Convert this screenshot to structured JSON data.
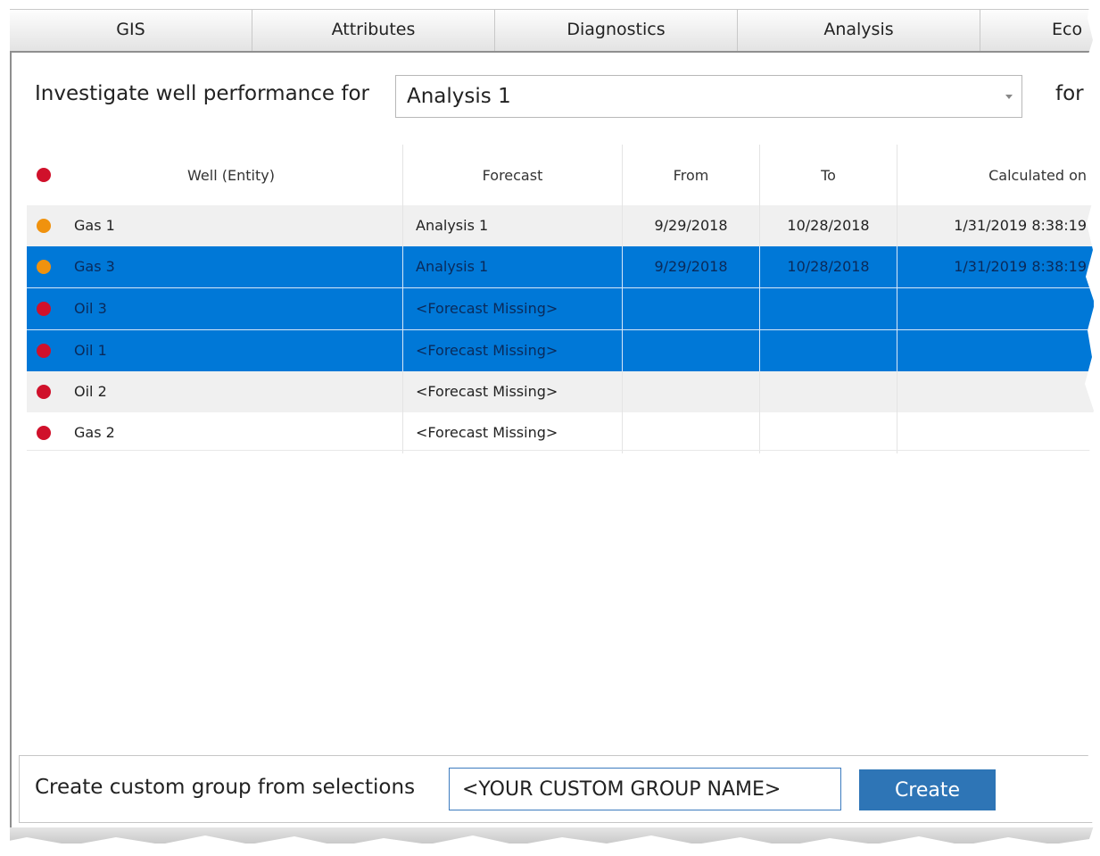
{
  "tabs": [
    "GIS",
    "Attributes",
    "Diagnostics",
    "Analysis",
    "Eco"
  ],
  "investigate": {
    "label": "Investigate well performance for",
    "selected": "Analysis 1",
    "trailing_label": "for"
  },
  "grid": {
    "headers": {
      "well": "Well (Entity)",
      "forecast": "Forecast",
      "from": "From",
      "to": "To",
      "calculated": "Calculated on"
    },
    "header_status_color": "#d0112b",
    "rows": [
      {
        "status": "#f0920e",
        "well": "Gas 1",
        "forecast": "Analysis 1",
        "from": "9/29/2018",
        "to": "10/28/2018",
        "calculated": "1/31/2019 8:38:19",
        "selected": false
      },
      {
        "status": "#f0920e",
        "well": "Gas 3",
        "forecast": "Analysis 1",
        "from": "9/29/2018",
        "to": "10/28/2018",
        "calculated": "1/31/2019 8:38:19",
        "selected": true
      },
      {
        "status": "#d0112b",
        "well": "Oil 3",
        "forecast": "<Forecast Missing>",
        "from": "",
        "to": "",
        "calculated": "",
        "selected": true
      },
      {
        "status": "#d0112b",
        "well": "Oil 1",
        "forecast": "<Forecast Missing>",
        "from": "",
        "to": "",
        "calculated": "",
        "selected": true
      },
      {
        "status": "#d0112b",
        "well": "Oil 2",
        "forecast": "<Forecast Missing>",
        "from": "",
        "to": "",
        "calculated": "",
        "selected": false
      },
      {
        "status": "#d0112b",
        "well": "Gas 2",
        "forecast": "<Forecast Missing>",
        "from": "",
        "to": "",
        "calculated": "",
        "selected": false
      }
    ]
  },
  "footer": {
    "label": "Create custom group from selections",
    "group_name_value": "<YOUR CUSTOM GROUP NAME>",
    "create_label": "Create"
  },
  "colors": {
    "selection": "#0078d7",
    "button": "#2e75b6",
    "status_red": "#d0112b",
    "status_orange": "#f0920e"
  }
}
